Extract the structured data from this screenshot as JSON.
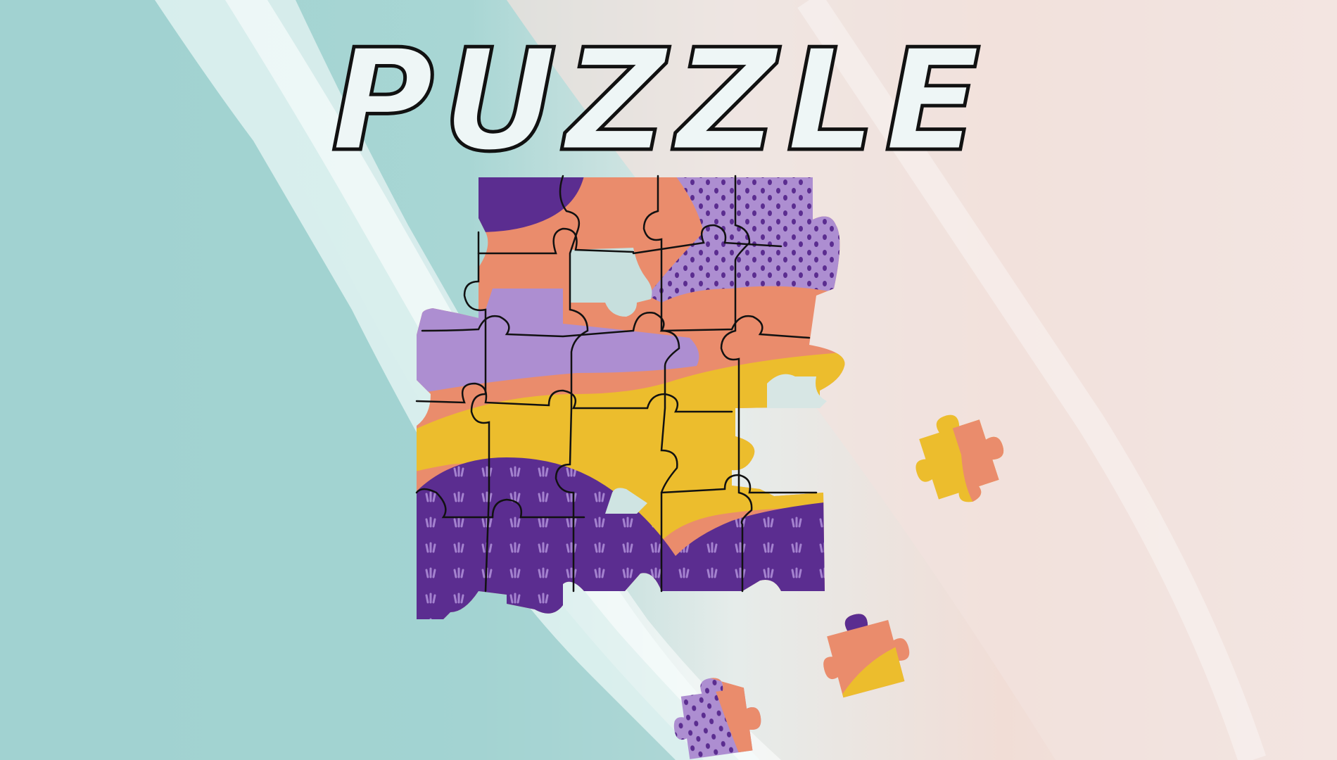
{
  "title": "PUZZLE",
  "colors": {
    "ocean": "#9fd3d2",
    "ocean_deep": "#8ccaca",
    "foam": "#f2fbfb",
    "sand": "#f3ddd6",
    "sand_light": "#f4ecea",
    "purple_dark": "#5b2d90",
    "purple_light": "#ad8ed1",
    "orange": "#ea8c6c",
    "yellow": "#ecbd2d",
    "outline": "#111111"
  },
  "puzzle": {
    "grid_columns": 4,
    "grid_rows": 4,
    "loose_pieces": [
      {
        "name": "loose-piece-yellow-orange",
        "colors": [
          "yellow",
          "orange"
        ]
      },
      {
        "name": "loose-piece-orange-yellow",
        "colors": [
          "orange",
          "yellow",
          "purple_dark"
        ]
      },
      {
        "name": "loose-piece-purple-dotted",
        "colors": [
          "purple_light",
          "orange"
        ]
      }
    ]
  }
}
